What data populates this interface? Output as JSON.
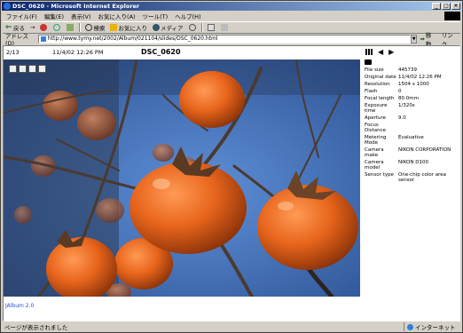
{
  "window": {
    "title": "DSC_0620 - Microsoft Internet Explorer"
  },
  "menu": [
    "ファイル(F)",
    "編集(E)",
    "表示(V)",
    "お気に入り(A)",
    "ツール(T)",
    "ヘルプ(H)"
  ],
  "toolbar": {
    "back": "戻る",
    "forward": "→",
    "search": "検索",
    "favorites": "お気に入り",
    "media": "メディア"
  },
  "address": {
    "label": "アドレス(D)",
    "url": "http://www.tymy.net/2002/Album/021104/slides/DSC_0620.html",
    "go": "移動",
    "links": "リンク"
  },
  "photo_header": {
    "counter": "2/13",
    "datetime": "11/4/02 12:26 PM",
    "name": "DSC_0620"
  },
  "exif": [
    {
      "k": "File size",
      "v": "445739"
    },
    {
      "k": "Original date",
      "v": "11/4/02 12:26 PM"
    },
    {
      "k": "Resolution",
      "v": "1504 x 1000"
    },
    {
      "k": "Flash",
      "v": "0"
    },
    {
      "k": "Focal length",
      "v": "80.0mm"
    },
    {
      "k": "Exposure time",
      "v": "1/320s"
    },
    {
      "k": "Aperture",
      "v": "9.0"
    },
    {
      "k": "Focus Distance",
      "v": ""
    },
    {
      "k": "Metering Mode",
      "v": "Evaluative"
    },
    {
      "k": "Camera make",
      "v": "NIKON CORPORATION"
    },
    {
      "k": "Camera model",
      "v": "NIKON D100"
    },
    {
      "k": "Sensor type",
      "v": "One-chip color area sensor"
    }
  ],
  "footer": {
    "link": "JAlbum 2.0"
  },
  "status": {
    "message": "ページが表示されました",
    "zone": "インターネット"
  }
}
